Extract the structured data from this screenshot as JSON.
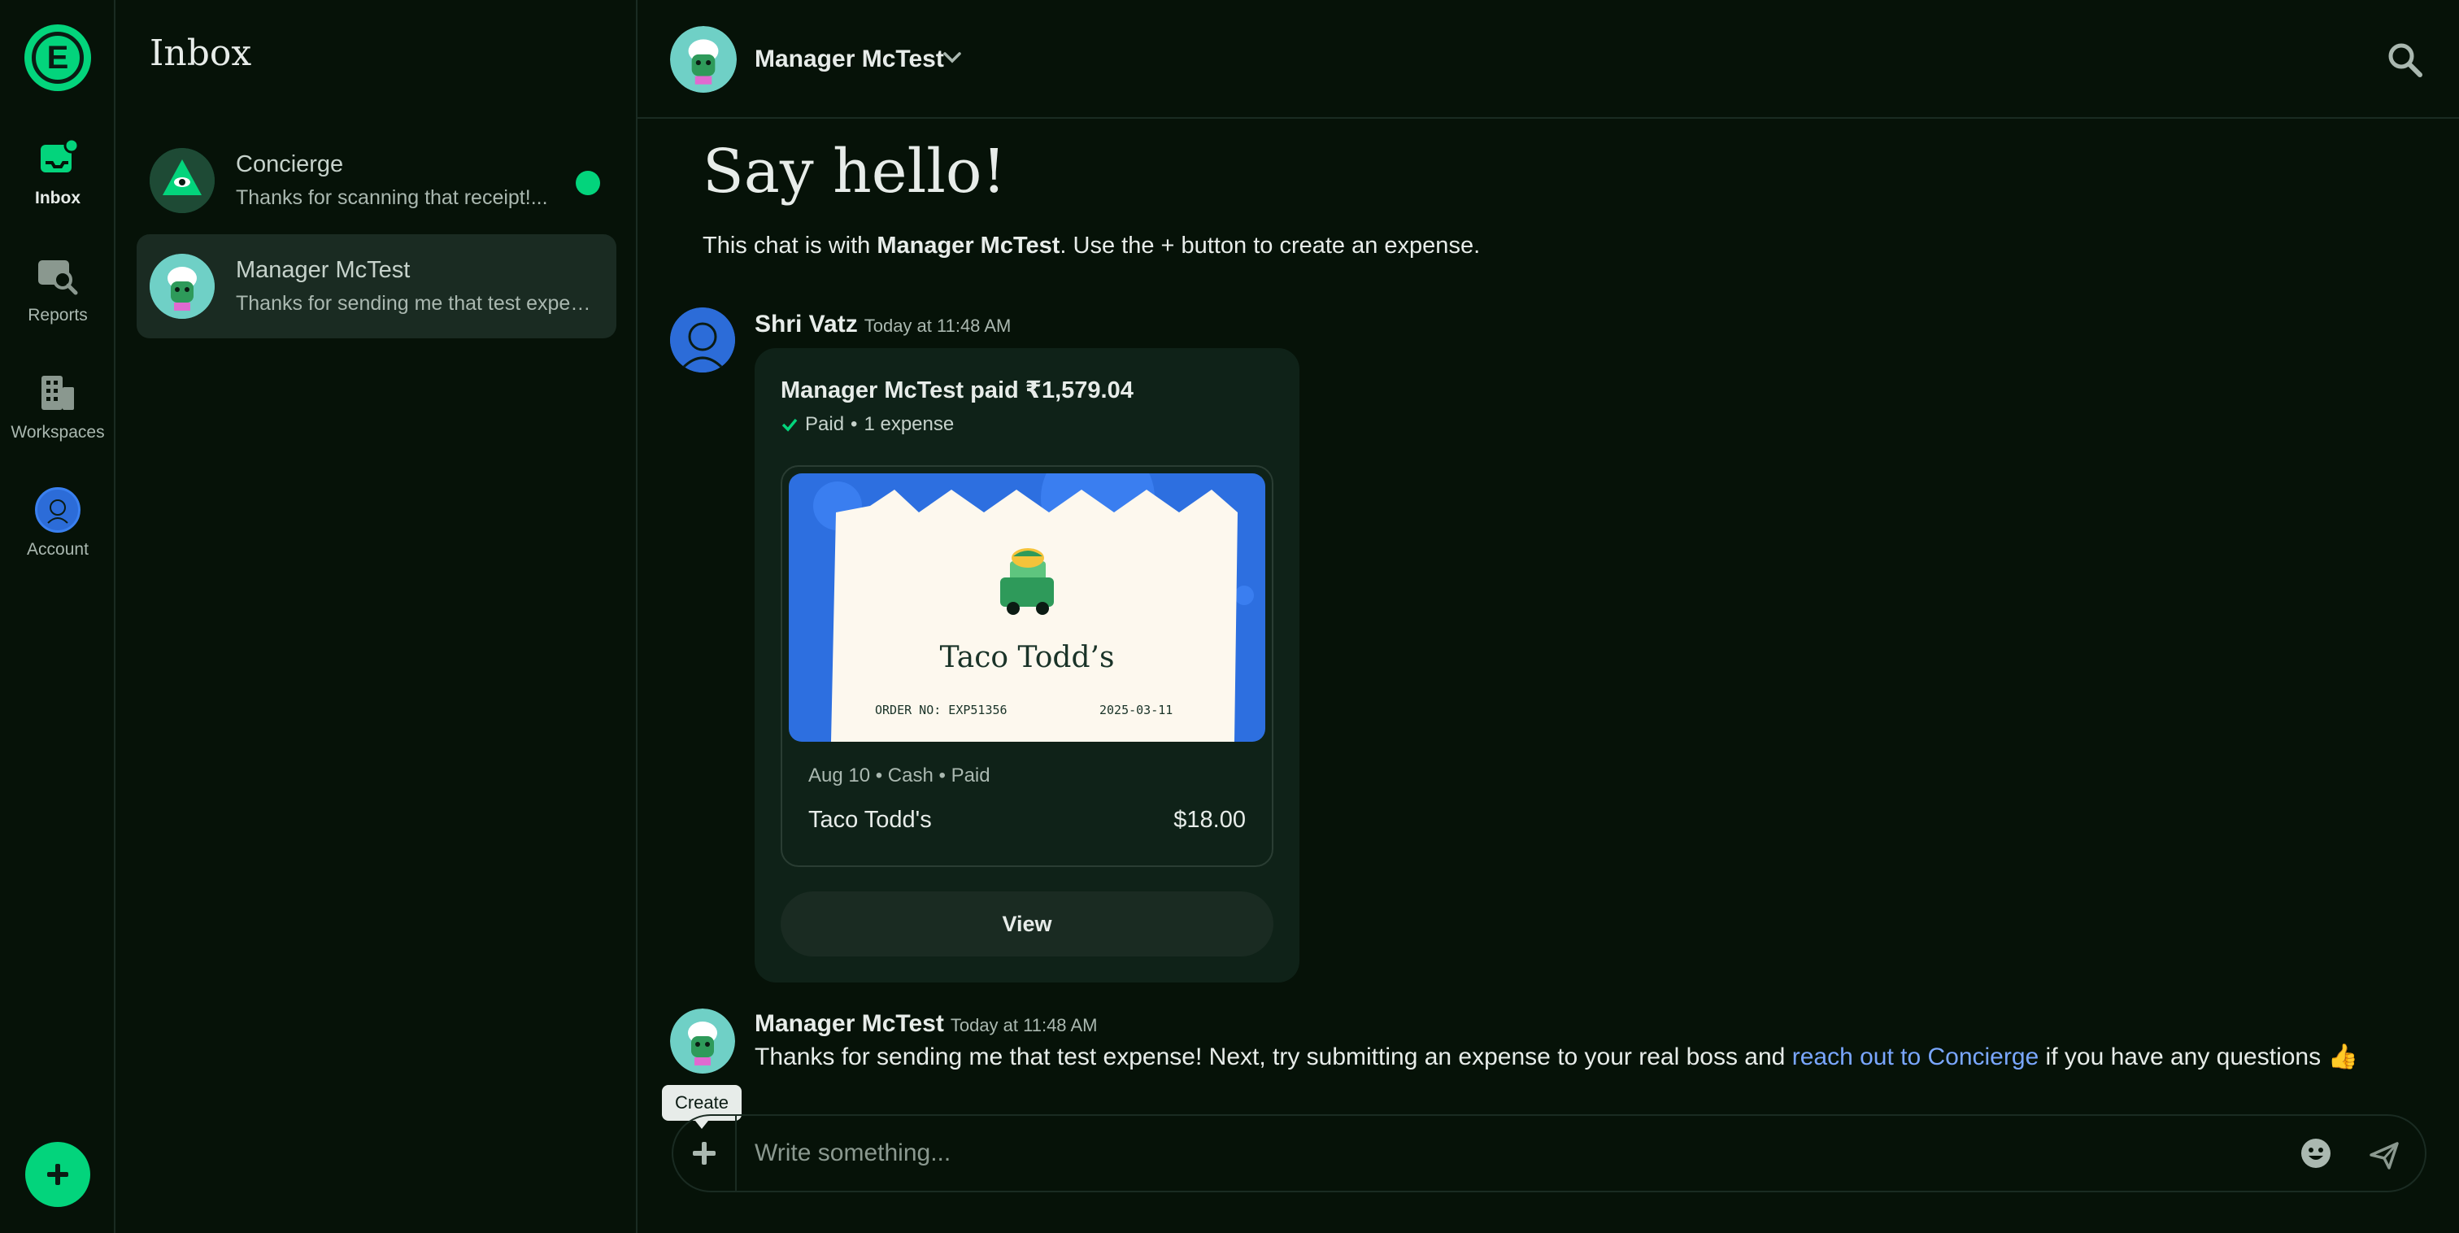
{
  "nav": {
    "logo_letter": "E",
    "items": [
      {
        "label": "Inbox",
        "icon": "inbox-icon"
      },
      {
        "label": "Reports",
        "icon": "reports-icon"
      },
      {
        "label": "Workspaces",
        "icon": "workspaces-icon"
      },
      {
        "label": "Account",
        "icon": "account-avatar"
      }
    ],
    "fab_icon": "plus-icon"
  },
  "list": {
    "title": "Inbox",
    "chats": [
      {
        "name": "Concierge",
        "preview": "Thanks for scanning that receipt!...",
        "unread": true
      },
      {
        "name": "Manager McTest",
        "preview": "Thanks for sending me that test expense! Next, try submitting...",
        "selected": true
      }
    ]
  },
  "header": {
    "name": "Manager McTest",
    "search_icon": "search-icon"
  },
  "chat": {
    "hello": "Say hello!",
    "intro_pre": "This chat is with ",
    "intro_name": "Manager McTest",
    "intro_post": ". Use the + button to create an expense.",
    "messages": [
      {
        "author": "Shri Vatz",
        "time": "Today at 11:48 AM",
        "report": {
          "title": "Manager McTest paid ₹1,579.04",
          "status": "Paid",
          "count": "1 expense",
          "receipt": {
            "merchant": "Taco Todd’s",
            "order": "ORDER NO: EXP51356",
            "date": "2025-03-11"
          },
          "meta": "Aug 10 • Cash • Paid",
          "merchant": "Taco Todd's",
          "amount": "$18.00",
          "view_label": "View"
        }
      },
      {
        "author": "Manager McTest",
        "time": "Today at 11:48 AM",
        "text_pre": "Thanks for sending me that test expense! Next, try submitting an expense to your real boss and ",
        "link": "reach out to Concierge",
        "text_post": " if you have any questions 👍"
      }
    ]
  },
  "composer": {
    "tooltip": "Create",
    "placeholder": "Write something..."
  },
  "colors": {
    "background": "#061208",
    "accent": "#03d47c",
    "card": "#0f2218",
    "link": "#7aa7ff"
  }
}
